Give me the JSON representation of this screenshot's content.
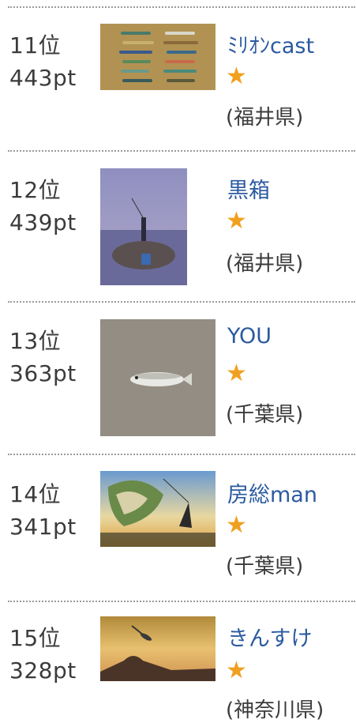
{
  "rankings": [
    {
      "rank": "11位",
      "points": "443pt",
      "name": "ﾐﾘｵﾝcast",
      "rating_icon": "star-icon",
      "prefecture": "(福井県)",
      "photo": "fishing-lures-photo"
    },
    {
      "rank": "12位",
      "points": "439pt",
      "name": "黒箱",
      "rating_icon": "star-icon",
      "prefecture": "(福井県)",
      "photo": "angler-on-rocks-photo"
    },
    {
      "rank": "13位",
      "points": "363pt",
      "name": "YOU",
      "rating_icon": "star-icon",
      "prefecture": "(千葉県)",
      "photo": "fish-on-ground-photo"
    },
    {
      "rank": "14位",
      "points": "341pt",
      "name": "房総man",
      "rating_icon": "star-icon",
      "prefecture": "(千葉県)",
      "photo": "bass-illustration-photo"
    },
    {
      "rank": "15位",
      "points": "328pt",
      "name": "きんすけ",
      "rating_icon": "star-icon",
      "prefecture": "(神奈川県)",
      "photo": "sunset-mountain-photo"
    }
  ],
  "colors": {
    "name_link": "#2b5aa0",
    "star": "#f0a020",
    "text": "#3b3b3b",
    "divider": "#9a9a9a"
  }
}
